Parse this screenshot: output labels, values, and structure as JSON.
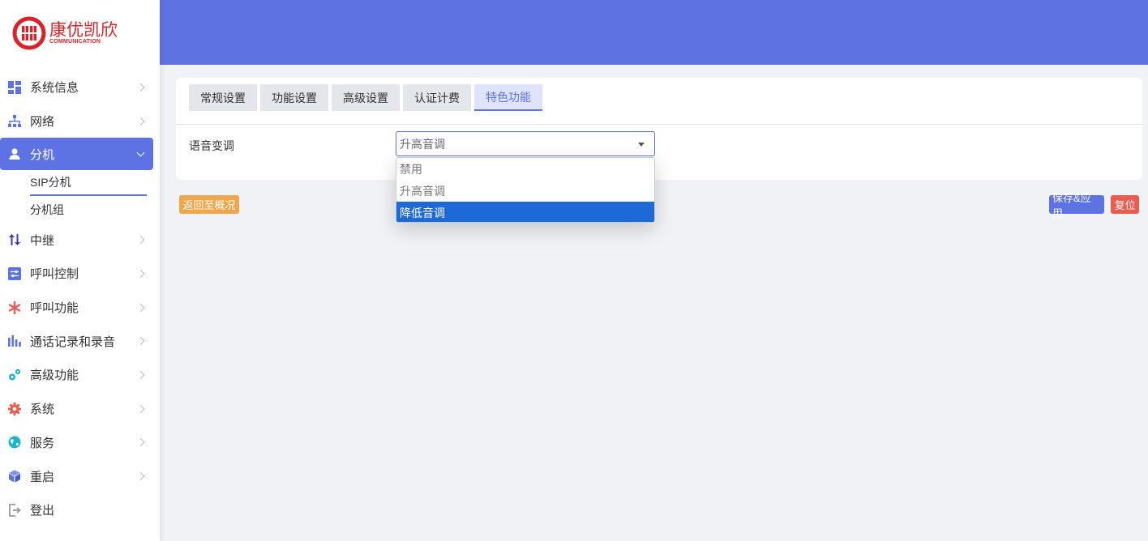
{
  "brand": {
    "name_cn": "康优凯欣",
    "name_en": "COMMUNICATION",
    "color": "#d9232a"
  },
  "sidebar": {
    "items": [
      {
        "label": "系统信息",
        "icon": "dashboard-icon",
        "color": "#5e73e3"
      },
      {
        "label": "网络",
        "icon": "network-tree-icon",
        "color": "#5e73e3"
      },
      {
        "label": "分机",
        "icon": "user-icon",
        "color": "#ffffff",
        "active": true
      },
      {
        "label": "中继",
        "icon": "trunk-arrows-icon",
        "color": "#5e73e3"
      },
      {
        "label": "呼叫控制",
        "icon": "sliders-icon",
        "color": "#5e73e3"
      },
      {
        "label": "呼叫功能",
        "icon": "asterisk-icon",
        "color": "#ec5c4e"
      },
      {
        "label": "通话记录和录音",
        "icon": "bar-chart-icon",
        "color": "#5e73e3"
      },
      {
        "label": "高级功能",
        "icon": "cogs-icon",
        "color": "#1bb6c9"
      },
      {
        "label": "系统",
        "icon": "gear-icon",
        "color": "#ec5c4e"
      },
      {
        "label": "服务",
        "icon": "globe-icon",
        "color": "#1bb6c9"
      },
      {
        "label": "重启",
        "icon": "cube-icon",
        "color": "#5e73e3"
      },
      {
        "label": "登出",
        "icon": "logout-icon",
        "color": "#999999"
      }
    ],
    "sub_items": [
      {
        "label": "SIP分机",
        "active": true
      },
      {
        "label": "分机组"
      }
    ]
  },
  "tabs": [
    {
      "label": "常规设置"
    },
    {
      "label": "功能设置"
    },
    {
      "label": "高级设置"
    },
    {
      "label": "认证计费"
    },
    {
      "label": "特色功能",
      "active": true
    }
  ],
  "form": {
    "voice_change": {
      "label": "语音变调",
      "value": "升高音调",
      "options": [
        "禁用",
        "升高音调",
        "降低音调"
      ],
      "highlighted": "降低音调"
    }
  },
  "buttons": {
    "back": "返回至概况",
    "save": "保存&应用",
    "reset": "复位"
  },
  "colors": {
    "accent": "#5e73e3",
    "header": "#5f72e2",
    "back": "#f1a64a",
    "reset": "#ec5c4e",
    "highlight": "#1d6ad6"
  }
}
